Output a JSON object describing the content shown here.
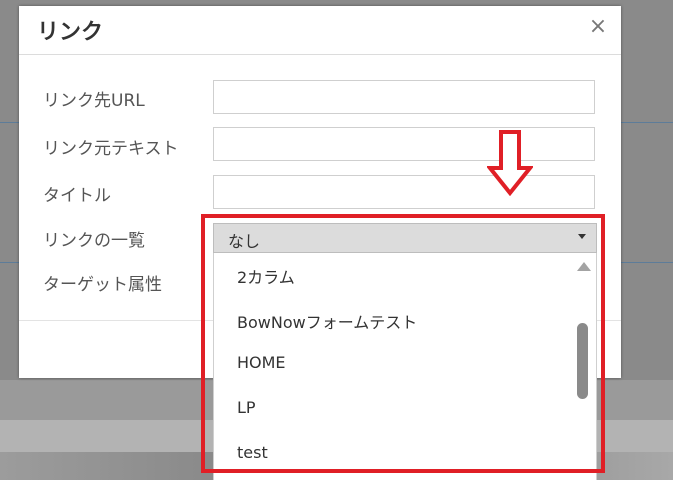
{
  "dialog": {
    "title": "リンク",
    "close_icon": "×",
    "fields": [
      {
        "label": "リンク先URL",
        "value": ""
      },
      {
        "label": "リンク元テキスト",
        "value": ""
      },
      {
        "label": "タイトル",
        "value": ""
      },
      {
        "label": "リンクの一覧"
      },
      {
        "label": "ターゲット属性"
      }
    ],
    "link_list": {
      "selected": "なし",
      "options": [
        "2カラム",
        "BowNowフォームテスト",
        "HOME",
        "LP",
        "test"
      ]
    }
  },
  "annotation": {
    "arrow_icon": "down-arrow-icon",
    "highlight_color": "#e01f26"
  }
}
